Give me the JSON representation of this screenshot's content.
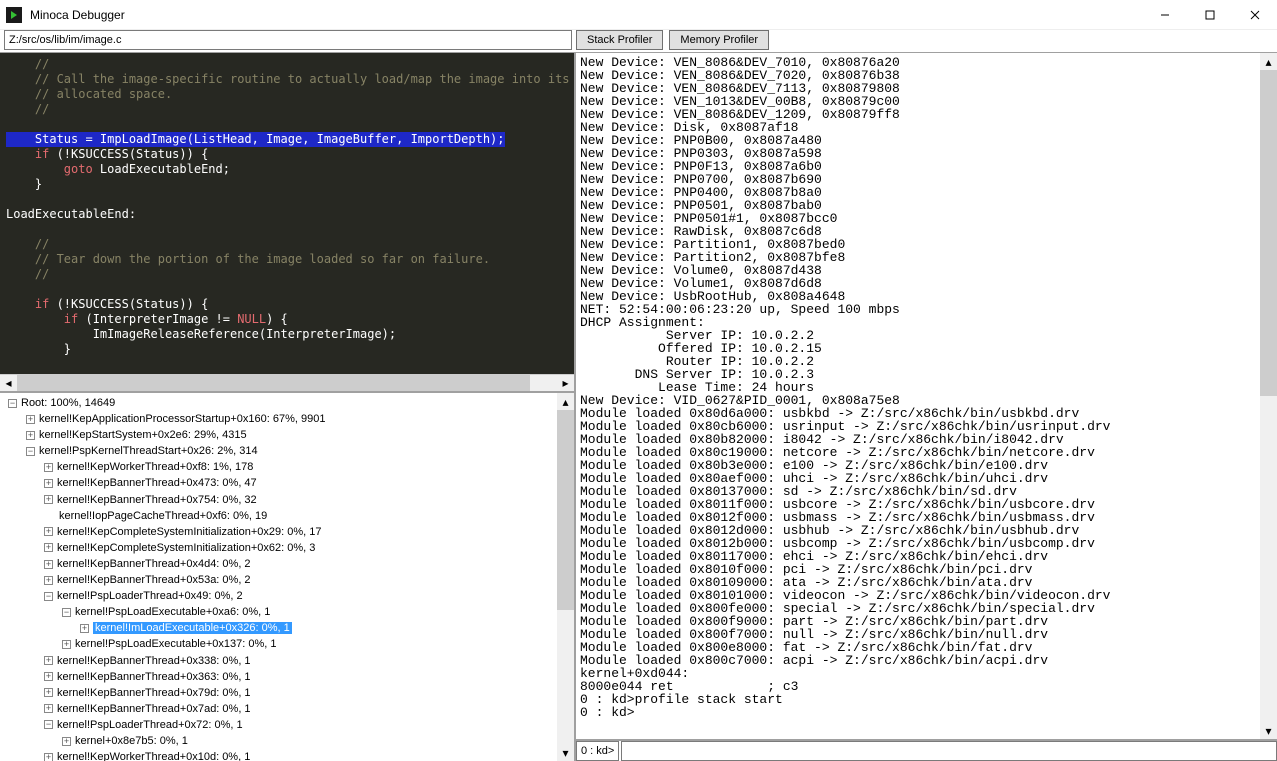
{
  "window": {
    "title": "Minoca Debugger"
  },
  "toolbar": {
    "path_value": "Z:/src/os/lib/im/image.c",
    "stack_profiler_label": "Stack Profiler",
    "memory_profiler_label": "Memory Profiler"
  },
  "code": {
    "l0": "    //",
    "l1": "    // Call the image-specific routine to actually load/map the image into its",
    "l2": "    // allocated space.",
    "l3": "    //",
    "l4": "",
    "l5a": "    Status = ImpLoadImage(ListHead, Image, ImageBuffer, ImportDepth);",
    "l6a": "    ",
    "l6b": "if",
    "l6c": " (!KSUCCESS(Status)) {",
    "l7a": "        ",
    "l7b": "goto",
    "l7c": " LoadExecutableEnd;",
    "l8": "    }",
    "l9": "",
    "l10": "LoadExecutableEnd:",
    "l11": "",
    "l12": "    //",
    "l13": "    // Tear down the portion of the image loaded so far on failure.",
    "l14": "    //",
    "l15": "",
    "l16a": "    ",
    "l16b": "if",
    "l16c": " (!KSUCCESS(Status)) {",
    "l17a": "        ",
    "l17b": "if",
    "l17c": " (InterpreterImage != ",
    "l17d": "NULL",
    "l17e": ") {",
    "l18": "            ImImageReleaseReference(InterpreterImage);",
    "l19": "        }"
  },
  "tree": {
    "root": "Root: 100%, 14649",
    "items": [
      {
        "depth": 1,
        "toggle": "+",
        "label": "kernel!KepApplicationProcessorStartup+0x160: 67%, 9901"
      },
      {
        "depth": 1,
        "toggle": "+",
        "label": "kernel!KepStartSystem+0x2e6: 29%, 4315"
      },
      {
        "depth": 1,
        "toggle": "−",
        "label": "kernel!PspKernelThreadStart+0x26: 2%, 314"
      },
      {
        "depth": 2,
        "toggle": "+",
        "label": "kernel!KepWorkerThread+0xf8: 1%, 178"
      },
      {
        "depth": 2,
        "toggle": "+",
        "label": "kernel!KepBannerThread+0x473: 0%, 47"
      },
      {
        "depth": 2,
        "toggle": "+",
        "label": "kernel!KepBannerThread+0x754: 0%, 32"
      },
      {
        "depth": 2,
        "toggle": "",
        "label": "kernel!IopPageCacheThread+0xf6: 0%, 19"
      },
      {
        "depth": 2,
        "toggle": "+",
        "label": "kernel!KepCompleteSystemInitialization+0x29: 0%, 17"
      },
      {
        "depth": 2,
        "toggle": "+",
        "label": "kernel!KepCompleteSystemInitialization+0x62: 0%, 3"
      },
      {
        "depth": 2,
        "toggle": "+",
        "label": "kernel!KepBannerThread+0x4d4: 0%, 2"
      },
      {
        "depth": 2,
        "toggle": "+",
        "label": "kernel!KepBannerThread+0x53a: 0%, 2"
      },
      {
        "depth": 2,
        "toggle": "−",
        "label": "kernel!PspLoaderThread+0x49: 0%, 2"
      },
      {
        "depth": 3,
        "toggle": "−",
        "label": "kernel!PspLoadExecutable+0xa6: 0%, 1"
      },
      {
        "depth": 4,
        "toggle": "+",
        "label": "kernel!ImLoadExecutable+0x326: 0%, 1",
        "selected": true
      },
      {
        "depth": 3,
        "toggle": "+",
        "label": "kernel!PspLoadExecutable+0x137: 0%, 1"
      },
      {
        "depth": 2,
        "toggle": "+",
        "label": "kernel!KepBannerThread+0x338: 0%, 1"
      },
      {
        "depth": 2,
        "toggle": "+",
        "label": "kernel!KepBannerThread+0x363: 0%, 1"
      },
      {
        "depth": 2,
        "toggle": "+",
        "label": "kernel!KepBannerThread+0x79d: 0%, 1"
      },
      {
        "depth": 2,
        "toggle": "+",
        "label": "kernel!KepBannerThread+0x7ad: 0%, 1"
      },
      {
        "depth": 2,
        "toggle": "−",
        "label": "kernel!PspLoaderThread+0x72: 0%, 1"
      },
      {
        "depth": 3,
        "toggle": "+",
        "label": "kernel+0x8e7b5: 0%, 1"
      },
      {
        "depth": 2,
        "toggle": "+",
        "label": "kernel!KepWorkerThread+0x10d: 0%, 1"
      }
    ]
  },
  "console_lines": [
    "New Device: VEN_8086&DEV_7010, 0x80876a20",
    "New Device: VEN_8086&DEV_7020, 0x80876b38",
    "New Device: VEN_8086&DEV_7113, 0x80879808",
    "New Device: VEN_1013&DEV_00B8, 0x80879c00",
    "New Device: VEN_8086&DEV_1209, 0x80879ff8",
    "New Device: Disk, 0x8087af18",
    "New Device: PNP0B00, 0x8087a480",
    "New Device: PNP0303, 0x8087a598",
    "New Device: PNP0F13, 0x8087a6b0",
    "New Device: PNP0700, 0x8087b690",
    "New Device: PNP0400, 0x8087b8a0",
    "New Device: PNP0501, 0x8087bab0",
    "New Device: PNP0501#1, 0x8087bcc0",
    "New Device: RawDisk, 0x8087c6d8",
    "New Device: Partition1, 0x8087bed0",
    "New Device: Partition2, 0x8087bfe8",
    "New Device: Volume0, 0x8087d438",
    "New Device: Volume1, 0x8087d6d8",
    "New Device: UsbRootHub, 0x808a4648",
    "NET: 52:54:00:06:23:20 up, Speed 100 mbps",
    "DHCP Assignment:",
    "           Server IP: 10.0.2.2",
    "          Offered IP: 10.0.2.15",
    "           Router IP: 10.0.2.2",
    "       DNS Server IP: 10.0.2.3",
    "          Lease Time: 24 hours",
    "New Device: VID_0627&PID_0001, 0x808a75e8",
    "Module loaded 0x80d6a000: usbkbd -> Z:/src/x86chk/bin/usbkbd.drv",
    "Module loaded 0x80cb6000: usrinput -> Z:/src/x86chk/bin/usrinput.drv",
    "Module loaded 0x80b82000: i8042 -> Z:/src/x86chk/bin/i8042.drv",
    "Module loaded 0x80c19000: netcore -> Z:/src/x86chk/bin/netcore.drv",
    "Module loaded 0x80b3e000: e100 -> Z:/src/x86chk/bin/e100.drv",
    "Module loaded 0x80aef000: uhci -> Z:/src/x86chk/bin/uhci.drv",
    "Module loaded 0x80137000: sd -> Z:/src/x86chk/bin/sd.drv",
    "Module loaded 0x8011f000: usbcore -> Z:/src/x86chk/bin/usbcore.drv",
    "Module loaded 0x8012f000: usbmass -> Z:/src/x86chk/bin/usbmass.drv",
    "Module loaded 0x8012d000: usbhub -> Z:/src/x86chk/bin/usbhub.drv",
    "Module loaded 0x8012b000: usbcomp -> Z:/src/x86chk/bin/usbcomp.drv",
    "Module loaded 0x80117000: ehci -> Z:/src/x86chk/bin/ehci.drv",
    "Module loaded 0x8010f000: pci -> Z:/src/x86chk/bin/pci.drv",
    "Module loaded 0x80109000: ata -> Z:/src/x86chk/bin/ata.drv",
    "Module loaded 0x80101000: videocon -> Z:/src/x86chk/bin/videocon.drv",
    "Module loaded 0x800fe000: special -> Z:/src/x86chk/bin/special.drv",
    "Module loaded 0x800f9000: part -> Z:/src/x86chk/bin/part.drv",
    "Module loaded 0x800f7000: null -> Z:/src/x86chk/bin/null.drv",
    "Module loaded 0x800e8000: fat -> Z:/src/x86chk/bin/fat.drv",
    "Module loaded 0x800c7000: acpi -> Z:/src/x86chk/bin/acpi.drv",
    "kernel+0xd044:",
    "8000e044 ret            ; c3",
    "0 : kd>profile stack start",
    "0 : kd>"
  ],
  "prompt": {
    "label": "0 : kd>",
    "value": ""
  }
}
